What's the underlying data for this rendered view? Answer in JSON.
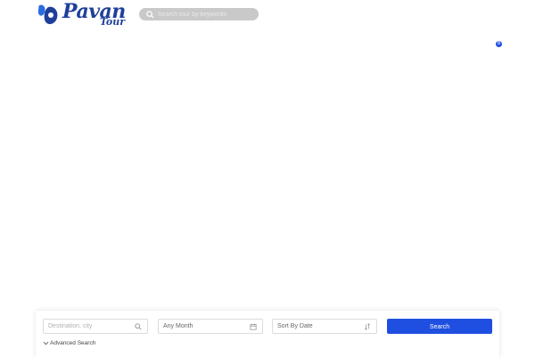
{
  "brand": {
    "name": "Pavan",
    "tagline": "Tour",
    "primary_color": "#1f3f9a",
    "accent_color": "#1f4fe0"
  },
  "header": {
    "search_placeholder": "Search tour by keywords",
    "search_icon": "search-icon",
    "cart_count": "0"
  },
  "search_panel": {
    "destination_placeholder": "Destination, city",
    "destination_icon": "search-icon",
    "month_value": "Any Month",
    "month_icon": "calendar-icon",
    "sort_value": "Sort By Date",
    "sort_icon": "sort-icon",
    "search_button": "Search",
    "advanced_label": "Advanced Search",
    "advanced_icon": "chevron-down-icon"
  }
}
